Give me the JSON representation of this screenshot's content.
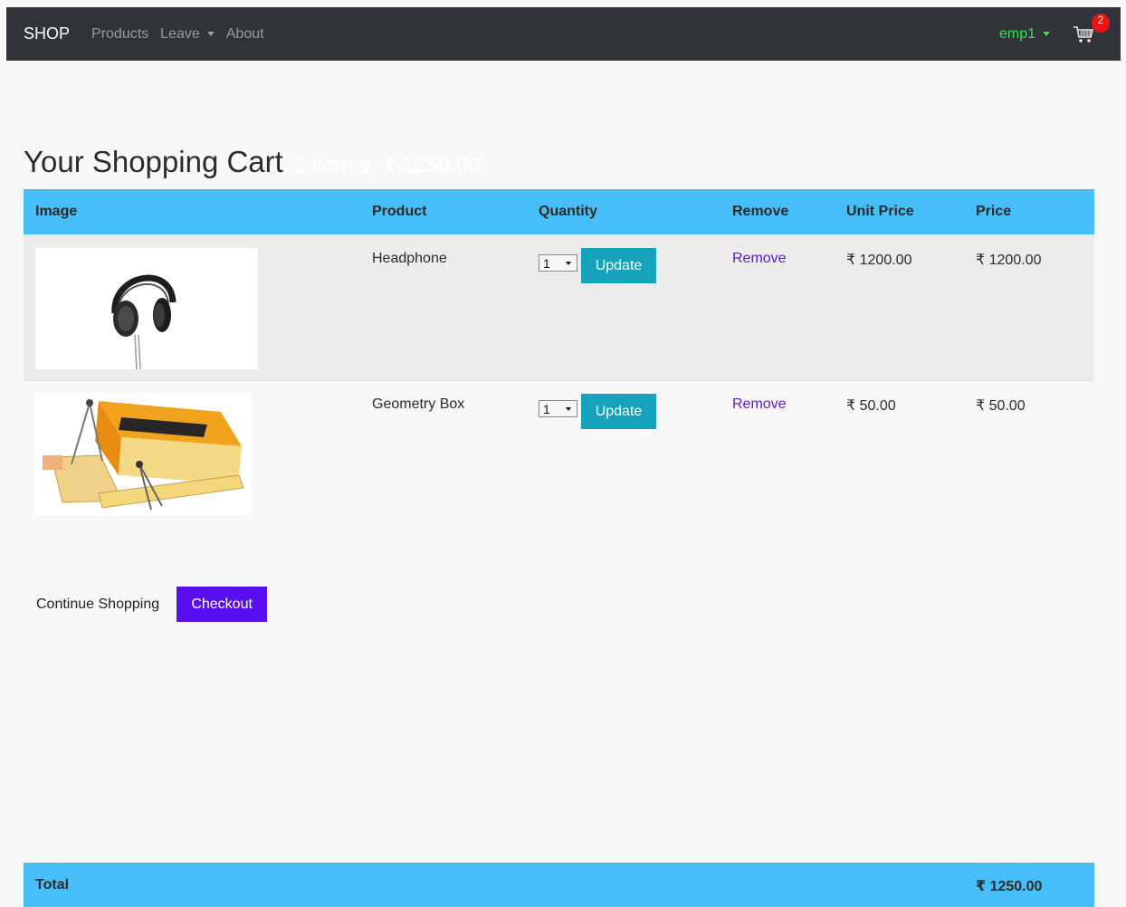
{
  "navbar": {
    "brand": "SHOP",
    "links": [
      "Products",
      "Leave",
      "About"
    ],
    "user": "emp1",
    "cart_count": "2"
  },
  "cart": {
    "title": "Your Shopping Cart",
    "summary": "2 item s, ₹ 1250.00",
    "headers": {
      "image": "Image",
      "product": "Product",
      "quantity": "Quantity",
      "remove": "Remove",
      "unit_price": "Unit Price",
      "price": "Price"
    },
    "items": [
      {
        "image_icon": "headphone-image",
        "product": "Headphone",
        "quantity": "1",
        "update_label": "Update",
        "remove_label": "Remove",
        "unit_price": "₹ 1200.00",
        "price": "₹ 1200.00"
      },
      {
        "image_icon": "geometry-box-image",
        "product": "Geometry Box",
        "quantity": "1",
        "update_label": "Update",
        "remove_label": "Remove",
        "unit_price": "₹ 50.00",
        "price": "₹ 50.00"
      }
    ],
    "total_label": "Total",
    "total_value": "₹ 1250.00"
  },
  "actions": {
    "continue_label": "Continue Shopping",
    "checkout_label": "Checkout"
  },
  "colors": {
    "navbar": "#303338",
    "table_header": "#46bff8",
    "update_button": "#14a3ba",
    "checkout_button": "#5a0ff0",
    "link": "#5b18d8",
    "user": "#22ee44",
    "badge": "#ee1111"
  }
}
